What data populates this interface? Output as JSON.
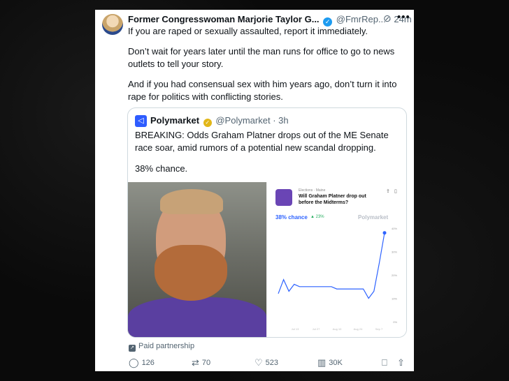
{
  "tweet": {
    "author_name": "Former Congresswoman Marjorie Taylor G...",
    "handle": "@FmrRep...",
    "time": "24m",
    "paragraphs": [
      "If you are raped or sexually assaulted, report it immediately.",
      "Don’t wait for years later until the man runs for office to go to news outlets to tell your story.",
      "And if you had consensual sex with him years ago, don’t turn it into rape for politics with conflicting stories."
    ]
  },
  "quote": {
    "author_name": "Polymarket",
    "handle": "@Polymarket",
    "time": "3h",
    "paragraphs": [
      "BREAKING: Odds Graham Platner drops out of the ME Senate race soar, amid rumors of a potential new scandal dropping.",
      "38% chance."
    ],
    "card": {
      "category": "Elections · Maine",
      "question": "Will Graham Platner drop out before the Midterms?",
      "chance": "38% chance",
      "delta": "▲ 23%",
      "brand": "Polymarket"
    }
  },
  "chart_data": {
    "type": "line",
    "series": [
      {
        "values": [
          12,
          18,
          13,
          16,
          15,
          15,
          15,
          15,
          15,
          15,
          15,
          14,
          14,
          14,
          14,
          14,
          14,
          10,
          13,
          25,
          38
        ]
      }
    ],
    "ylim": [
      0,
      40
    ],
    "yticks": [
      "40%",
      "30%",
      "20%",
      "10%",
      "0%"
    ],
    "xticks": [
      "Jul 13",
      "Jul 27",
      "Aug 10",
      "Aug 24",
      "Sep 7"
    ],
    "grid": false,
    "color": "#2d62ff"
  },
  "paid_label": "Paid partnership",
  "actions": {
    "replies": "126",
    "reposts": "70",
    "likes": "523",
    "views": "30K"
  },
  "colors": {
    "accent": "#1d9bf0",
    "brand": "#2e5cff",
    "muted": "#536471"
  }
}
